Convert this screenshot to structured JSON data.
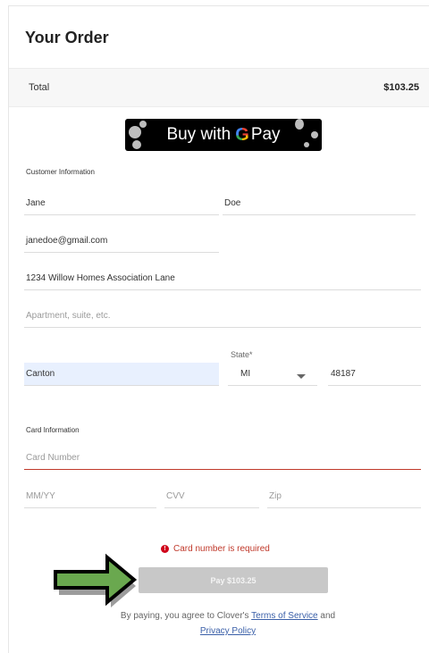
{
  "order": {
    "title": "Your Order",
    "total_label": "Total",
    "total_amount": "$103.25"
  },
  "gpay": {
    "label": "Buy with",
    "g": "G",
    "pay": "Pay"
  },
  "customer": {
    "section_label": "Customer Information",
    "first_name": "Jane",
    "last_name": "Doe",
    "email": "janedoe@gmail.com",
    "address": "1234 Willow Homes Association Lane",
    "apartment_placeholder": "Apartment, suite, etc.",
    "city": "Canton",
    "state_label": "State*",
    "state": "MI",
    "zip": "48187"
  },
  "card": {
    "section_label": "Card Information",
    "number_placeholder": "Card Number",
    "expiry_placeholder": "MM/YY",
    "cvv_placeholder": "CVV",
    "zip_placeholder": "Zip"
  },
  "error": {
    "message": "Card number is required"
  },
  "pay_button": {
    "label": "Pay $103.25"
  },
  "legal": {
    "prefix": "By paying, you agree to Clover's ",
    "terms_link": "Terms of Service",
    "middle": " and ",
    "privacy_link": "Privacy Policy"
  },
  "colors": {
    "error": "#c0392b",
    "link": "#3a5fa8",
    "autofill": "#e8f0fe",
    "arrow_fill": "#6aa84f",
    "button_disabled": "#c8c8c8"
  }
}
